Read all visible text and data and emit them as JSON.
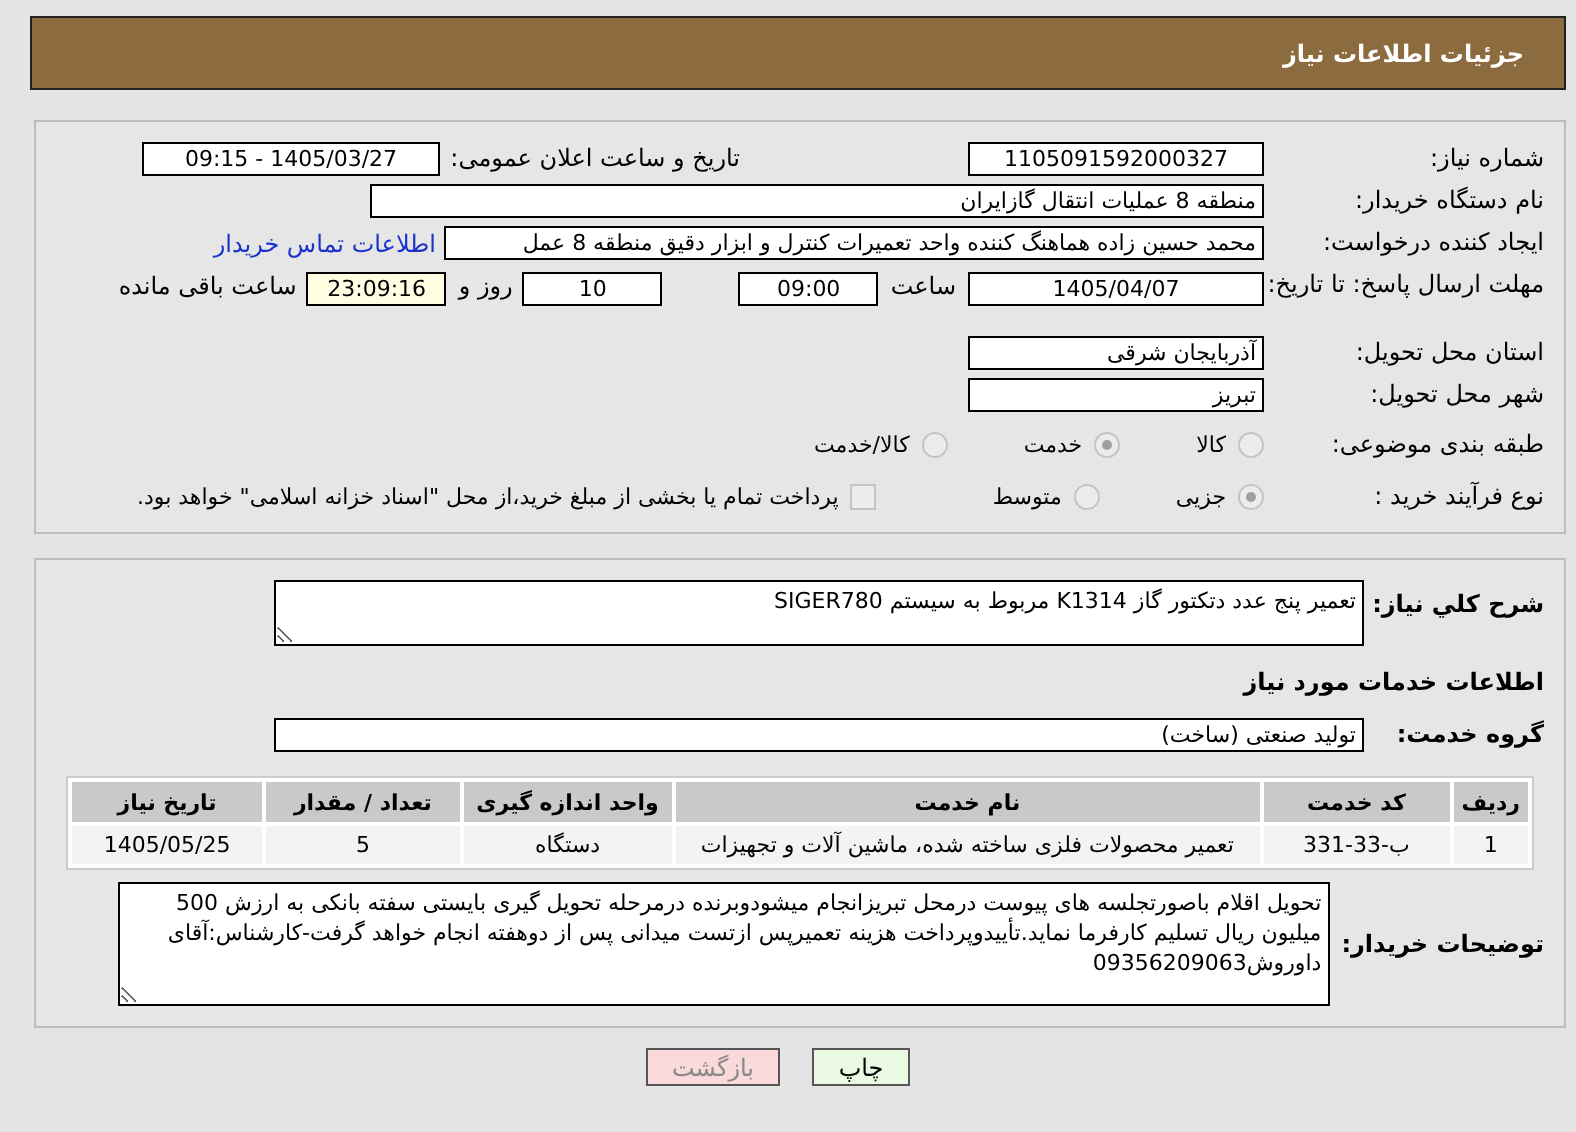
{
  "header": {
    "title": "جزئیات اطلاعات نیاز"
  },
  "need_number": {
    "label": "شماره نیاز:",
    "value": "1105091592000327"
  },
  "announce": {
    "label": "تاریخ و ساعت اعلان عمومی:",
    "value": "1405/03/27 - 09:15"
  },
  "buyer": {
    "label": "نام دستگاه خریدار:",
    "value": "منطقه 8 عملیات انتقال گازایران"
  },
  "creator": {
    "label": "ایجاد کننده درخواست:",
    "value": "محمد حسین زاده هماهنگ کننده واحد تعمیرات کنترل و ابزار دقیق منطقه 8 عمل",
    "link": "اطلاعات تماس خریدار"
  },
  "deadline": {
    "label": "مهلت ارسال پاسخ: تا تاریخ:",
    "date": "1405/04/07",
    "time_label": "ساعت",
    "time": "09:00",
    "days": "10",
    "days_label": "روز و",
    "remaining": "23:09:16",
    "remaining_label": "ساعت باقی مانده"
  },
  "province": {
    "label": "استان محل تحویل:",
    "value": "آذربایجان شرقی"
  },
  "city": {
    "label": "شهر محل تحویل:",
    "value": "تبریز"
  },
  "category": {
    "label": "طبقه بندی موضوعی:",
    "options": [
      {
        "label": "کالا",
        "selected": false
      },
      {
        "label": "خدمت",
        "selected": true
      },
      {
        "label": "کالا/خدمت",
        "selected": false
      }
    ]
  },
  "process": {
    "label": "نوع فرآیند خرید :",
    "options": [
      {
        "label": "جزیی",
        "selected": true
      },
      {
        "label": "متوسط",
        "selected": false
      }
    ],
    "payment": {
      "label": "پرداخت تمام یا بخشی از مبلغ خرید،از محل \"اسناد خزانه اسلامی\" خواهد بود.",
      "checked": false
    }
  },
  "description": {
    "label": "شرح کلي نياز:",
    "value": "تعمیر پنج عدد دتکتور گاز K1314 مربوط به سیستم SIGER780"
  },
  "services_title": "اطلاعات خدمات مورد نیاز",
  "service_group": {
    "label": "گروه خدمت:",
    "value": "تولید صنعتی (ساخت)"
  },
  "table": {
    "columns": [
      "ردیف",
      "کد خدمت",
      "نام خدمت",
      "واحد اندازه گیری",
      "تعداد / مقدار",
      "تاریخ نیاز"
    ],
    "rows": [
      [
        "1",
        "ب-33-331",
        "تعمیر محصولات فلزی ساخته شده، ماشین آلات و تجهیزات",
        "دستگاه",
        "5",
        "1405/05/25"
      ]
    ]
  },
  "notes": {
    "label": "توضیحات خریدار:",
    "value": "تحویل اقلام باصورتجلسه های پیوست درمحل تبریزانجام میشودوبرنده درمرحله تحویل گیری بایستی سفته بانکی به ارزش 500 میلیون ریال تسلیم کارفرما نماید.تأییدوپرداخت هزینه تعمیرپس ازتست میدانی پس از دوهفته انجام خواهد گرفت-کارشناس:آقای داوروش09356209063"
  },
  "buttons": [
    {
      "label": "چاپ",
      "kind": "print"
    },
    {
      "label": "بازگشت",
      "kind": "back"
    }
  ]
}
